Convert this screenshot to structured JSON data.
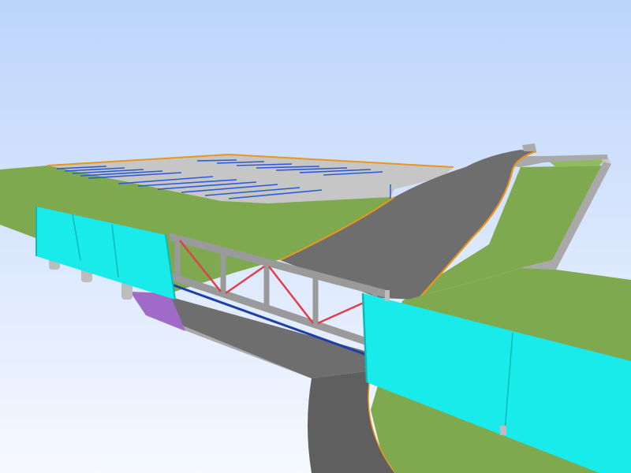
{
  "viewport": {
    "kind": "3d-model-viewport",
    "colors": {
      "sky_top": "#bcd4fb",
      "sky_bottom": "#f6f9ff",
      "grass": "#7fa94f",
      "grass_light": "#8fbb59",
      "asphalt": "#6e6e6e",
      "asphalt_dark": "#5f5f5f",
      "concrete": "#a9a9a9",
      "concrete_light": "#c6c6c6",
      "parking_line": "#2a5bd7",
      "edge_orange": "#e8961e",
      "noise_wall": "#19eaea",
      "noise_wall_edge": "#0fb7b7",
      "truss": "#9a9a9a",
      "truss_bracing": "#e0404a",
      "deck_edge": "#1c3fa8",
      "abutment": "#a06bc8",
      "pier": "#bdbdbd"
    }
  }
}
